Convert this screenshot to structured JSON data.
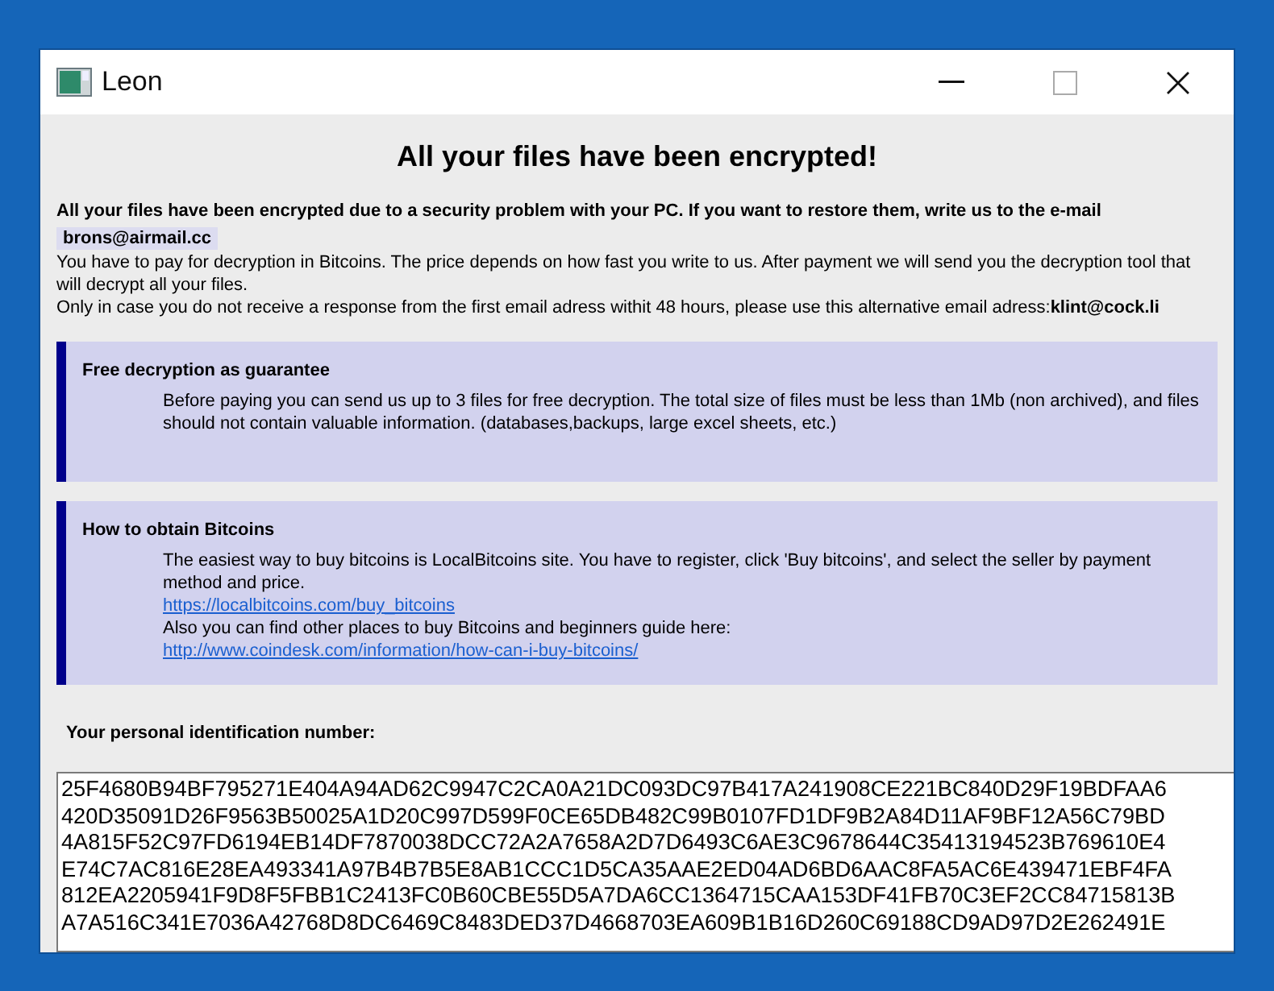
{
  "window": {
    "title": "Leon"
  },
  "heading": "All your files have been encrypted!",
  "intro": {
    "lead": "All your files have been encrypted due to a security problem with your PC. If you want to restore them, write us to the e-mail",
    "email": "brons@airmail.cc",
    "paragraphs": [
      "You have to pay for decryption in Bitcoins. The price depends on how fast you write to us. After payment we will send you the decryption tool that will decrypt all your files.",
      "Only in case you do not receive a response from the first email adress withit 48 hours, please use this alternative email adress:**klint@cock.li**"
    ]
  },
  "sections": [
    {
      "title": "Free decryption as guarantee",
      "lines": [
        {
          "kind": "text",
          "text": "Before paying you can send us up to 3 files for free decryption. The total size of files must be less than 1Mb (non archived), and files should not contain valuable information. (databases,backups, large excel sheets, etc.)"
        }
      ]
    },
    {
      "title": "How to obtain Bitcoins",
      "lines": [
        {
          "kind": "text",
          "text": "The easiest way to buy bitcoins is LocalBitcoins site. You have to register, click 'Buy bitcoins', and select the seller by payment method and price."
        },
        {
          "kind": "link",
          "text": "https://localbitcoins.com/buy_bitcoins"
        },
        {
          "kind": "text",
          "text": "Also you can find other places to buy Bitcoins and beginners guide here:"
        },
        {
          "kind": "link",
          "text": "http://www.coindesk.com/information/how-can-i-buy-bitcoins/"
        }
      ]
    }
  ],
  "id_label": "Your personal identification number:",
  "id_lines": [
    "25F4680B94BF795271E404A94AD62C9947C2CA0A21DC093DC97B417A241908CE221BC840D29F19BDFAA6",
    "420D35091D26F9563B50025A1D20C997D599F0CE65DB482C99B0107FD1DF9B2A84D11AF9BF12A56C79BD",
    "4A815F52C97FD6194EB14DF7870038DCC72A2A7658A2D7D6493C6AE3C9678644C35413194523B769610E4",
    "E74C7AC816E28EA493341A97B4B7B5E8AB1CCC1D5CA35AAE2ED04AD6BD6AAC8FA5AC6E439471EBF4FA",
    "812EA2205941F9D8F5FBB1C2413FC0B60CBE55D5A7DA6CC1364715CAA153DF41FB70C3EF2CC84715813B",
    "A7A516C341E7036A42768D8DC6469C8483DED37D4668703EA609B1B16D260C69188CD9AD97D2E262491E"
  ]
}
